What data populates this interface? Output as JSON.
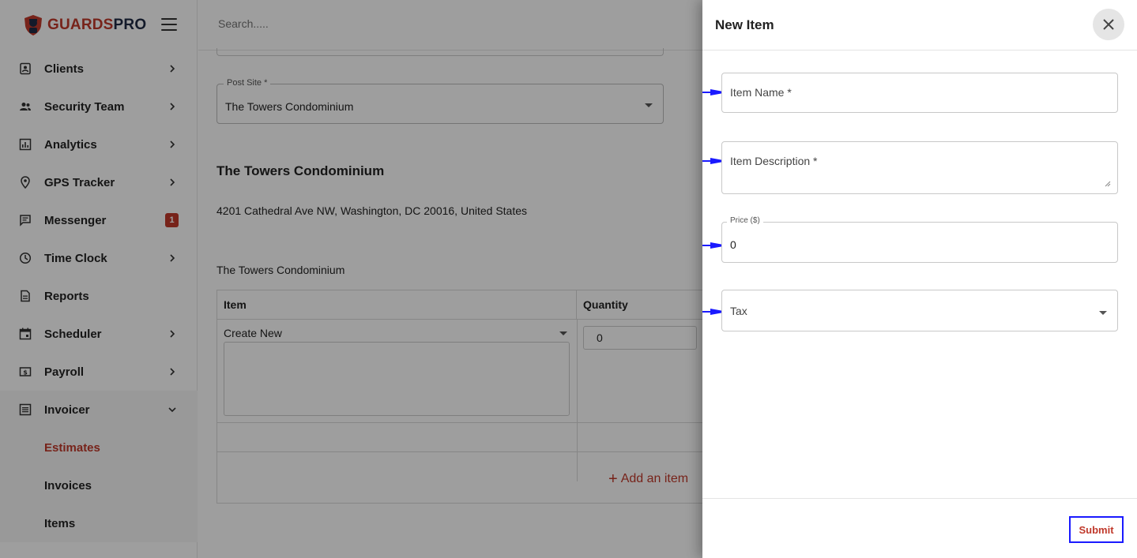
{
  "brand": {
    "name_part1": "GUARDS",
    "name_part2": "PRO",
    "accent": "#c0392b",
    "dark": "#1f2a44"
  },
  "topbar": {
    "search_placeholder": "Search....."
  },
  "sidebar": {
    "items": [
      {
        "label": "Clients",
        "icon": "clients-icon"
      },
      {
        "label": "Security Team",
        "icon": "team-icon"
      },
      {
        "label": "Analytics",
        "icon": "analytics-icon"
      },
      {
        "label": "GPS Tracker",
        "icon": "location-pin-icon"
      },
      {
        "label": "Messenger",
        "icon": "chat-icon",
        "badge": "1"
      },
      {
        "label": "Time Clock",
        "icon": "clock-icon"
      },
      {
        "label": "Reports",
        "icon": "document-icon"
      },
      {
        "label": "Scheduler",
        "icon": "calendar-icon"
      },
      {
        "label": "Payroll",
        "icon": "dollar-icon"
      },
      {
        "label": "Invoicer",
        "icon": "list-icon"
      }
    ],
    "invoicer_sub": [
      "Estimates",
      "Invoices",
      "Items"
    ]
  },
  "main": {
    "post_site_label": "Post Site *",
    "post_site_value": "The Towers Condominium",
    "site_title": "The Towers Condominium",
    "site_address": "4201 Cathedral Ave NW, Washington, DC 20016, United States",
    "site_subtitle": "The Towers Condominium",
    "table": {
      "headers": [
        "Item",
        "Quantity"
      ],
      "item_select": "Create New",
      "quantity": "0",
      "add_item": "Add an item"
    }
  },
  "drawer": {
    "title": "New Item",
    "fields": {
      "item_name_placeholder": "Item Name *",
      "item_description_placeholder": "Item Description *",
      "price_label": "Price ($)",
      "price_value": "0",
      "tax_placeholder": "Tax"
    },
    "submit_label": "Submit"
  }
}
